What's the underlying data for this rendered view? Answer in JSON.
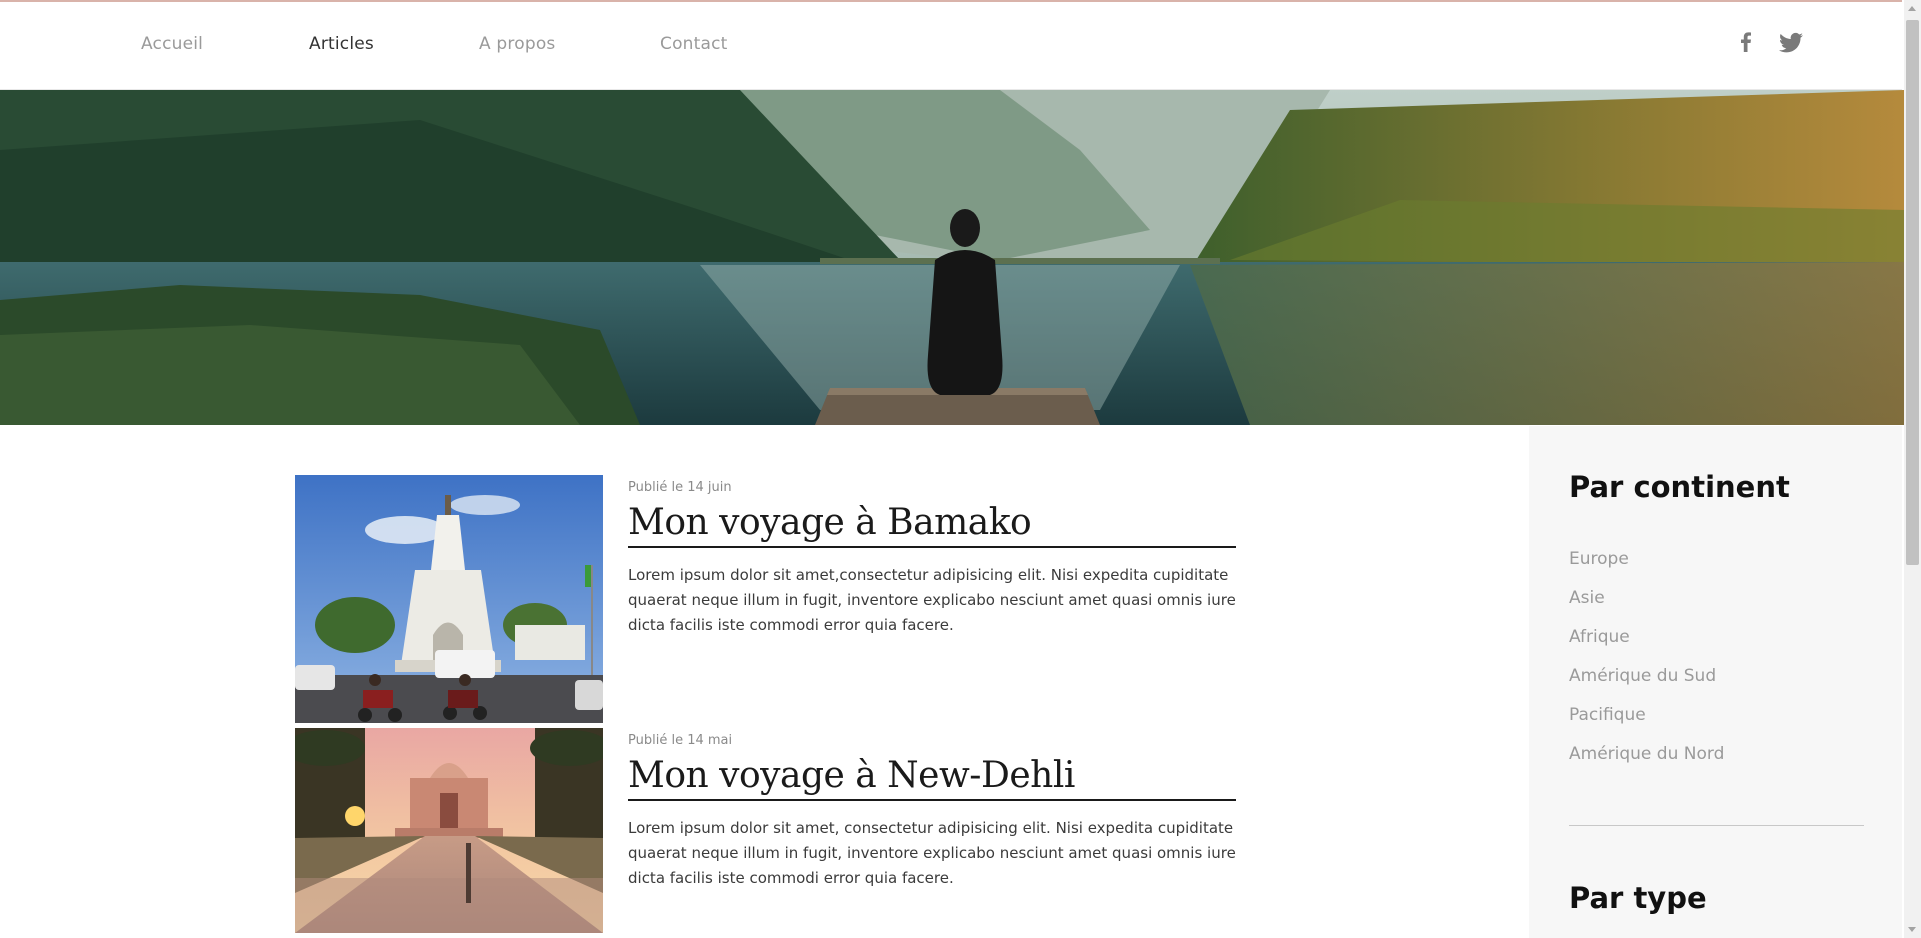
{
  "nav": {
    "items": [
      {
        "label": "Accueil",
        "active": false
      },
      {
        "label": "Articles",
        "active": true
      },
      {
        "label": "A propos",
        "active": false
      },
      {
        "label": "Contact",
        "active": false
      }
    ]
  },
  "social": {
    "facebook_icon": "facebook-icon",
    "twitter_icon": "twitter-icon"
  },
  "articles": [
    {
      "date": "Publié le 14 juin",
      "title": "Mon voyage à Bamako",
      "excerpt": "Lorem ipsum dolor sit amet,consectetur adipisicing elit. Nisi expedita cupiditate quaerat neque illum in fugit, inventore explicabo nesciunt amet quasi omnis iure dicta facilis iste commodi error quia facere."
    },
    {
      "date": "Publié le 14 mai",
      "title": "Mon voyage à New-Dehli",
      "excerpt": "Lorem ipsum dolor sit amet, consectetur adipisicing elit. Nisi expedita cupiditate quaerat neque illum in fugit, inventore explicabo nesciunt amet quasi omnis iure dicta facilis iste commodi error quia facere."
    }
  ],
  "sidebar": {
    "continent_title": "Par continent",
    "continents": [
      "Europe",
      "Asie",
      "Afrique",
      "Amérique du Sud",
      "Pacifique",
      "Amérique du Nord"
    ],
    "type_title": "Par type"
  },
  "colors": {
    "accent_line": "#d9b3aa",
    "text_dark": "#1a1a1a",
    "muted": "#9a9a9a",
    "sidebar_bg": "#f7f7f7"
  }
}
